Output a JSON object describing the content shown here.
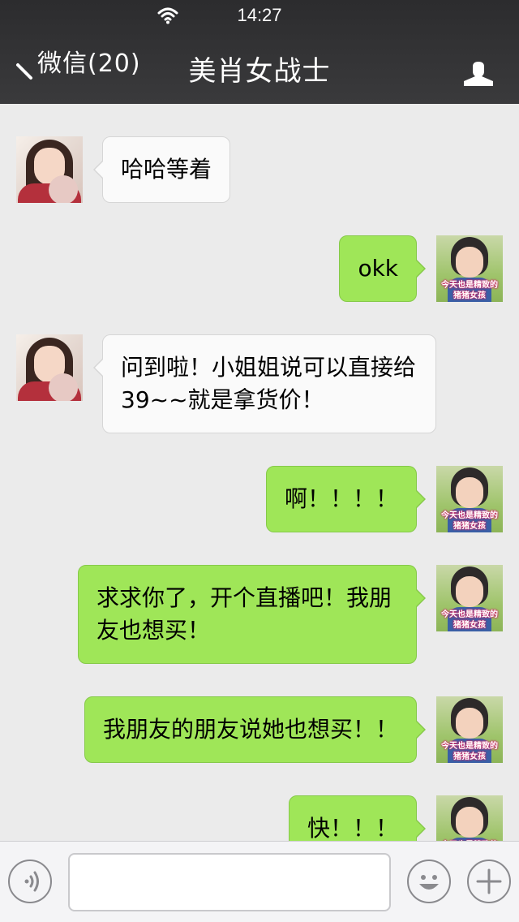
{
  "status_bar": {
    "time": "14:27",
    "wifi_icon": "wifi-icon"
  },
  "nav": {
    "back_label": "微信(20)",
    "back_icon": "chevron-left-icon",
    "title": "美肖女战士",
    "profile_icon": "person-icon"
  },
  "messages": [
    {
      "side": "in",
      "avatar": "girl-avatar",
      "text": "哈哈等着"
    },
    {
      "side": "out",
      "avatar": "kid-sticker-avatar",
      "text": "okk"
    },
    {
      "side": "in",
      "avatar": "girl-avatar",
      "text": "问到啦！小姐姐说可以直接给39~~就是拿货价！"
    },
    {
      "side": "out",
      "avatar": "kid-sticker-avatar",
      "text": "啊！！！！"
    },
    {
      "side": "out",
      "avatar": "kid-sticker-avatar",
      "text": "求求你了，开个直播吧！我朋友也想买！"
    },
    {
      "side": "out",
      "avatar": "kid-sticker-avatar",
      "text": "我朋友的朋友说她也想买！！"
    },
    {
      "side": "out",
      "avatar": "kid-sticker-avatar",
      "text": "快！！！"
    }
  ],
  "sticker_caption": {
    "line1": "今天也是精致的",
    "line2": "猪猪女孩"
  },
  "input_bar": {
    "voice_icon": "voice-icon",
    "text_value": "",
    "emoji_icon": "smiley-icon",
    "plus_icon": "plus-icon"
  },
  "colors": {
    "header_bg": "#333335",
    "outgoing_bubble": "#9fe658",
    "incoming_bubble": "#fafafa",
    "chat_bg": "#ebebeb"
  }
}
